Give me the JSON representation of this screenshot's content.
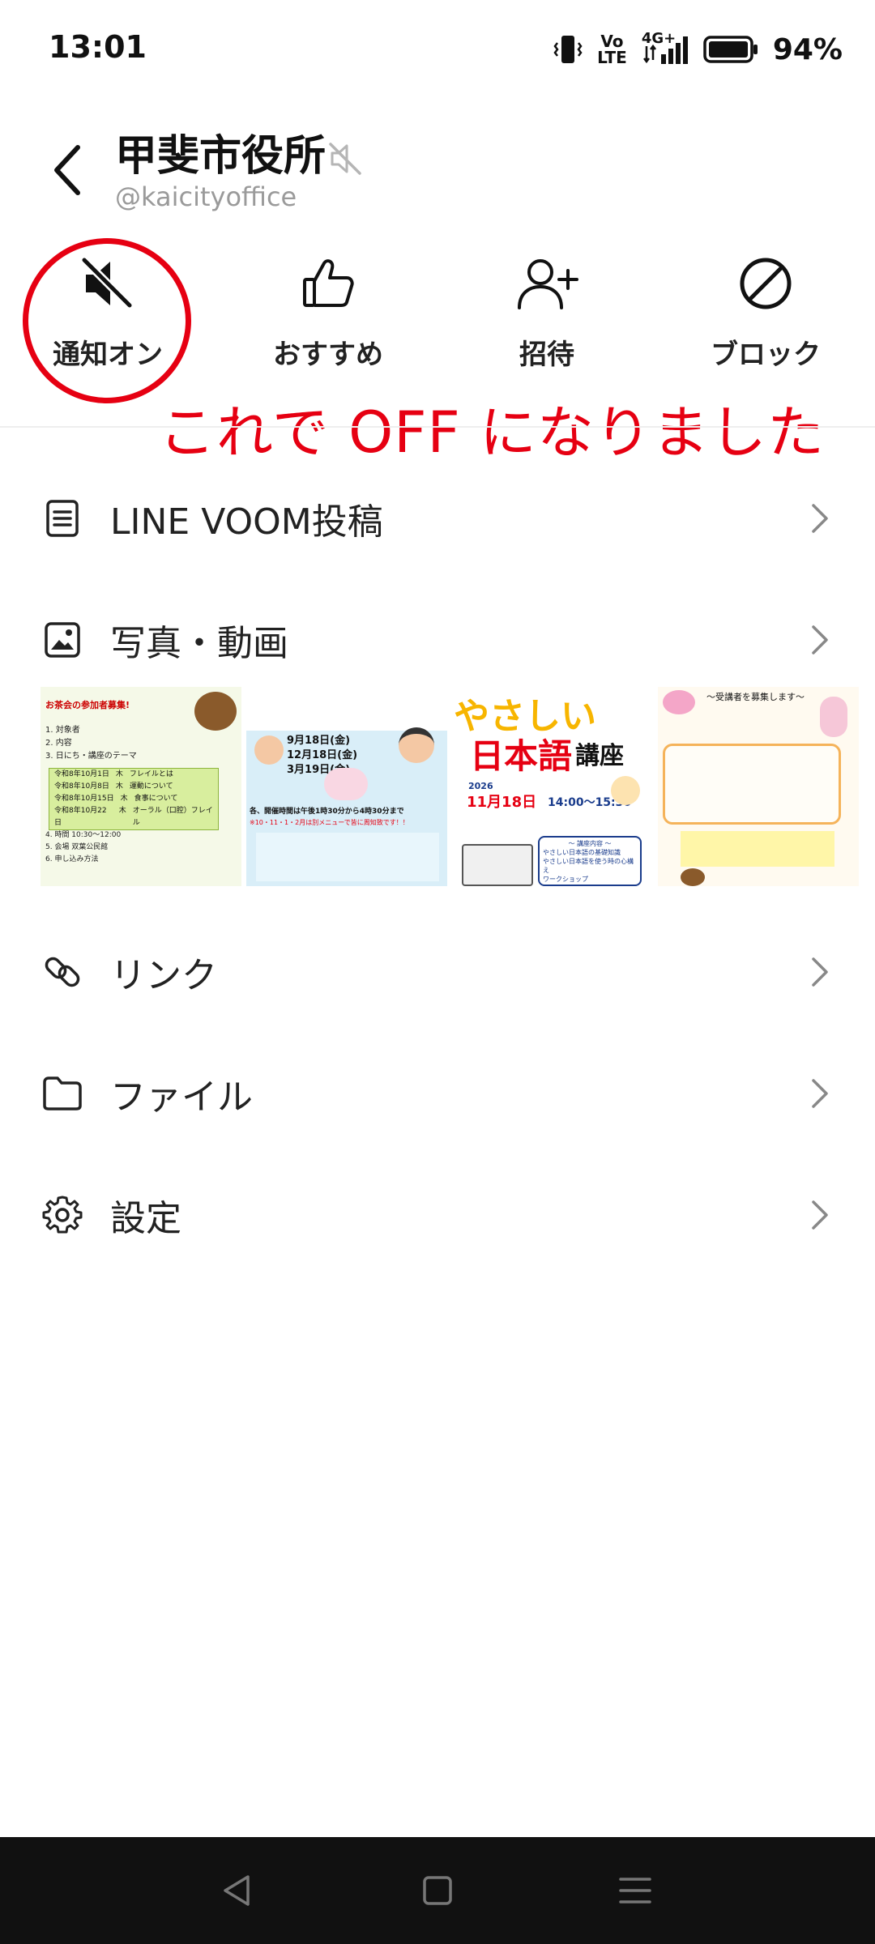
{
  "status_bar": {
    "time": "13:01",
    "volte_top": "Vo",
    "volte_bottom": "LTE",
    "network": "4G+",
    "battery": "94%"
  },
  "header": {
    "account_name": "甲斐市役所",
    "handle": "@kaicityoffice"
  },
  "actions": [
    {
      "label": "通知オン",
      "icon": "speaker-muted-icon"
    },
    {
      "label": "おすすめ",
      "icon": "thumbs-up-icon"
    },
    {
      "label": "招待",
      "icon": "add-person-icon"
    },
    {
      "label": "ブロック",
      "icon": "block-icon"
    }
  ],
  "annotation": "これで OFF になりました",
  "annotation_color": "#e60012",
  "menu": [
    {
      "label": "LINE VOOM投稿",
      "icon": "document-icon"
    },
    {
      "label": "写真・動画",
      "icon": "photo-icon"
    },
    {
      "label": "リンク",
      "icon": "link-icon"
    },
    {
      "label": "ファイル",
      "icon": "folder-icon"
    },
    {
      "label": "設定",
      "icon": "gear-icon"
    }
  ],
  "thumbnails": {
    "t1": {
      "headline": "お茶会の参加者募集!",
      "items": [
        "1. 対象者",
        "2. 内容",
        "3. 日にち・講座のテーマ"
      ],
      "rows": [
        [
          "令和8年10月1日",
          "木",
          "フレイルとは"
        ],
        [
          "令和8年10月8日",
          "木",
          "運動について"
        ],
        [
          "令和8年10月15日",
          "木",
          "食事について"
        ],
        [
          "令和8年10月22日",
          "木",
          "オーラル（口腔）フレイル"
        ]
      ],
      "footer": [
        "4. 時間 10:30～12:00",
        "5. 会場 双葉公民館",
        "6. 申し込み方法"
      ]
    },
    "t2": {
      "dates": [
        "9月18日(金)",
        "12月18日(金)",
        "3月19日(金)"
      ],
      "time_line": "各、開催時間は午後1時30分から4時30分まで",
      "note": "※10・11・1・2月は別メニューで皆に周知致です！！"
    },
    "t3": {
      "title_top": "やさしい",
      "title_main": "日本語",
      "title_suffix": "講座",
      "year": "2026",
      "date": "11月18日",
      "time": "14:00～15:30",
      "content_header": "～ 講座内容 ～",
      "contents": [
        "やさしい日本語の基礎知識",
        "やさしい日本語を使う時の心構え",
        "ワークショップ"
      ]
    },
    "t4": {
      "header": "～受講者を募集します～"
    }
  }
}
